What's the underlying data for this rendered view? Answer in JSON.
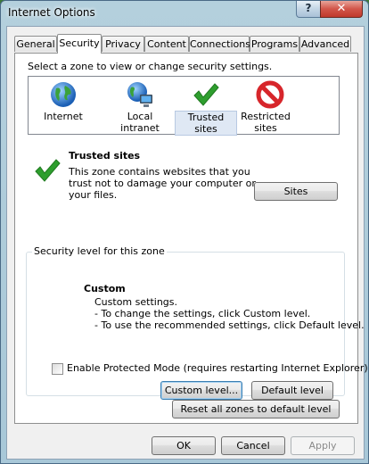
{
  "window": {
    "title": "Internet Options",
    "help": "?",
    "close": "✕"
  },
  "tabs": [
    {
      "label": "General"
    },
    {
      "label": "Security"
    },
    {
      "label": "Privacy"
    },
    {
      "label": "Content"
    },
    {
      "label": "Connections"
    },
    {
      "label": "Programs"
    },
    {
      "label": "Advanced"
    }
  ],
  "active_tab": "Security",
  "security": {
    "prompt": "Select a zone to view or change security settings.",
    "zones": [
      {
        "label": "Internet",
        "icon": "globe-icon"
      },
      {
        "label": "Local intranet",
        "icon": "network-globe-icon"
      },
      {
        "label": "Trusted sites",
        "icon": "checkmark-icon"
      },
      {
        "label": "Restricted sites",
        "icon": "restricted-icon"
      }
    ],
    "selected_zone": "Trusted sites",
    "zone_heading": "Trusted sites",
    "zone_desc": [
      "This zone contains websites that you",
      "trust not to damage your computer or",
      "your files."
    ],
    "sites_button": "Sites",
    "level_group_title": "Security level for this zone",
    "level_name": "Custom",
    "level_desc": [
      "Custom settings.",
      "- To change the settings, click Custom level.",
      "- To use the recommended settings, click Default level."
    ],
    "protected_mode_label": "Enable Protected Mode (requires restarting Internet Explorer)",
    "protected_mode_checked": false,
    "custom_level_button": "Custom level...",
    "default_level_button": "Default level",
    "reset_button": "Reset all zones to default level"
  },
  "footer": {
    "ok": "OK",
    "cancel": "Cancel",
    "apply": "Apply"
  },
  "colors": {
    "titlebar": "#b9d4ea",
    "close": "#c0392b",
    "check_green": "#2e9e2e",
    "restricted_red": "#d7262b"
  }
}
